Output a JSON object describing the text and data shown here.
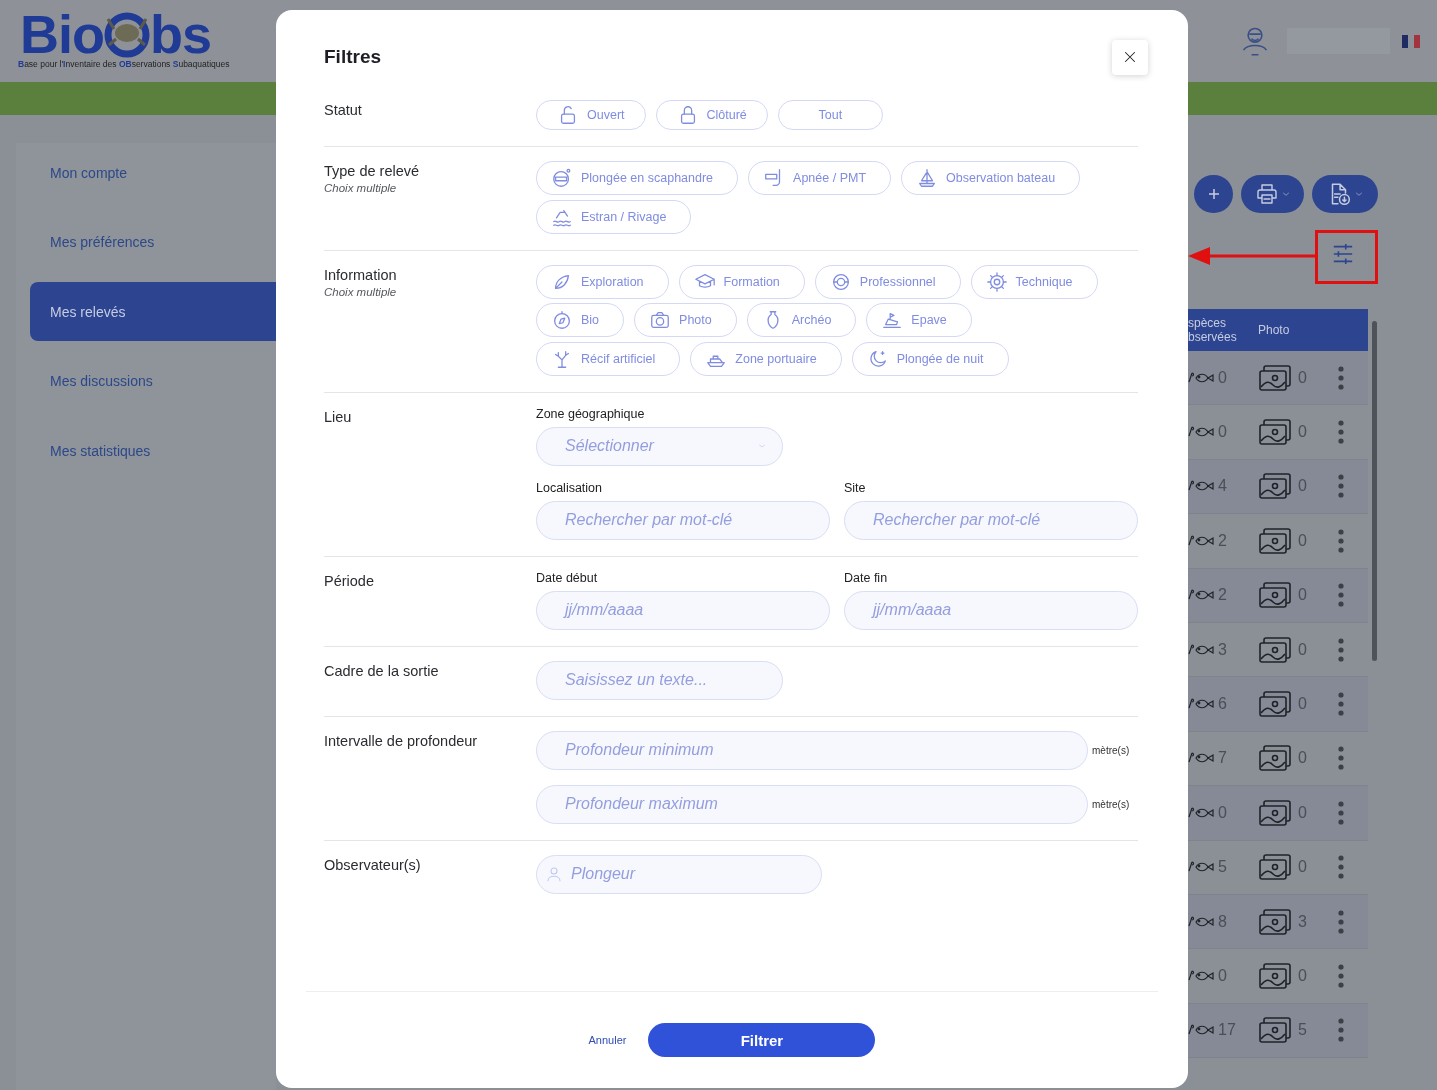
{
  "header": {
    "logo_start": "Bio",
    "logo_end": "bs",
    "tagline": "**B**ase pour l'**I**nventaire des **OB**servations **S**ubaquatiques"
  },
  "sidebar": {
    "items": [
      {
        "label": "Mon compte",
        "selected": false
      },
      {
        "label": "Mes préférences",
        "selected": false
      },
      {
        "label": "Mes relevés",
        "selected": true
      },
      {
        "label": "Mes discussions",
        "selected": false
      },
      {
        "label": "Mes statistiques",
        "selected": false
      }
    ]
  },
  "table": {
    "columns": [
      "spèces bservées",
      "Photo"
    ],
    "rows": [
      {
        "species": "0",
        "photos": "0"
      },
      {
        "species": "0",
        "photos": "0"
      },
      {
        "species": "4",
        "photos": "0"
      },
      {
        "species": "2",
        "photos": "0"
      },
      {
        "species": "2",
        "photos": "0"
      },
      {
        "species": "3",
        "photos": "0"
      },
      {
        "species": "6",
        "photos": "0"
      },
      {
        "species": "7",
        "photos": "0"
      },
      {
        "species": "0",
        "photos": "0"
      },
      {
        "species": "5",
        "photos": "0"
      },
      {
        "species": "8",
        "photos": "3"
      },
      {
        "species": "0",
        "photos": "0"
      },
      {
        "species": "17",
        "photos": "5"
      }
    ]
  },
  "modal": {
    "title": "Filtres",
    "sections": [
      {
        "kind": "chips",
        "label": "Statut",
        "chips": [
          {
            "label": "Ouvert",
            "selected": false
          },
          {
            "label": "Clôturé",
            "selected": false
          },
          {
            "label": "Tout",
            "selected": false
          }
        ]
      },
      {
        "kind": "chips",
        "label": "Type de relevé",
        "hint": "Choix multiple",
        "chips": [
          {
            "label": "Plongée en scaphandre",
            "selected": false
          },
          {
            "label": "Apnée / PMT",
            "selected": false
          },
          {
            "label": "Observation bateau",
            "selected": false
          },
          {
            "label": "Estran / Rivage",
            "selected": false
          }
        ]
      },
      {
        "kind": "chips",
        "label": "Information",
        "hint": "Choix multiple",
        "chips": [
          {
            "label": "Exploration",
            "selected": false
          },
          {
            "label": "Formation",
            "selected": false
          },
          {
            "label": "Professionnel",
            "selected": false
          },
          {
            "label": "Technique",
            "selected": false
          },
          {
            "label": "Bio",
            "selected": false
          },
          {
            "label": "Photo",
            "selected": false
          },
          {
            "label": "Archéo",
            "selected": false
          },
          {
            "label": "Epave",
            "selected": false
          },
          {
            "label": "Récif artificiel",
            "selected": false
          },
          {
            "label": "Zone portuaire",
            "selected": false
          },
          {
            "label": "Plongée de nuit",
            "selected": false
          }
        ]
      },
      {
        "kind": "fields",
        "label": "Lieu",
        "rows": [
          [
            {
              "kind": "select",
              "label": "Zone géographique",
              "placeholder": "Sélectionner"
            }
          ],
          [
            {
              "kind": "search",
              "label": "Localisation",
              "placeholder": "Rechercher par mot-clé"
            },
            {
              "kind": "search",
              "label": "Site",
              "placeholder": "Rechercher par mot-clé"
            }
          ]
        ]
      },
      {
        "kind": "fields",
        "label": "Période",
        "rows": [
          [
            {
              "kind": "date",
              "label": "Date début",
              "placeholder": "jj/mm/aaaa"
            },
            {
              "kind": "date",
              "label": "Date fin",
              "placeholder": "jj/mm/aaaa"
            }
          ]
        ]
      },
      {
        "kind": "fields",
        "label": "Cadre de la sortie",
        "rows": [
          [
            {
              "kind": "note",
              "placeholder": "Saisissez un texte..."
            }
          ]
        ]
      },
      {
        "kind": "fields",
        "label": "Intervalle de profondeur",
        "rows": [
          [
            {
              "kind": "depth",
              "placeholder": "Profondeur minimum",
              "unit": "mètre(s)"
            }
          ],
          [
            {
              "kind": "depth",
              "placeholder": "Profondeur maximum",
              "unit": "mètre(s)"
            }
          ]
        ]
      },
      {
        "kind": "fields",
        "label": "Observateur(s)",
        "rows": [
          [
            {
              "kind": "person",
              "placeholder": "Plongeur"
            }
          ]
        ]
      }
    ],
    "cancel": "Annuler",
    "submit": "Filtrer"
  }
}
